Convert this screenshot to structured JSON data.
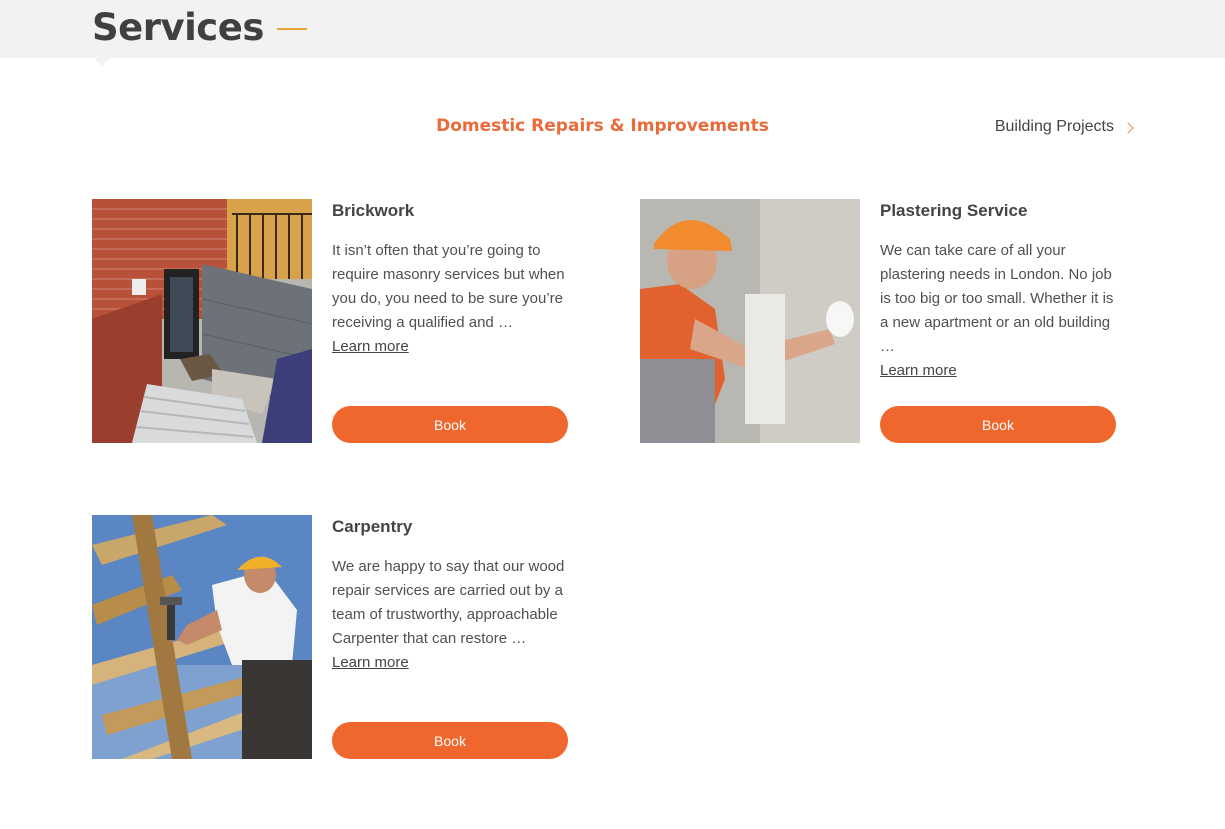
{
  "header": {
    "title": "Services"
  },
  "nav": {
    "category_title": "Domestic Repairs & Improvements",
    "next_label": "Building Projects"
  },
  "services": [
    {
      "title": "Brickwork",
      "description": "It isn’t often that you’re going to require masonry services but when you do, you need to be sure you’re receiving a qualified and …",
      "learn_more": "Learn more",
      "book_label": "Book"
    },
    {
      "title": "Plastering Service",
      "description": "We can take care of all your plastering needs in London. No job is too big or too small. Whether it is a new apartment or an old building …",
      "learn_more": "Learn more",
      "book_label": "Book"
    },
    {
      "title": "Carpentry",
      "description": "We are happy to say that our wood repair services are carried out by a team of trustworthy, approachable Carpenter that can restore …",
      "learn_more": "Learn more",
      "book_label": "Book"
    }
  ],
  "colors": {
    "accent": "#f0672e",
    "category_title": "#ea6a3a",
    "header_band": "#f2f2f2",
    "title_dash": "#e9a43a"
  }
}
